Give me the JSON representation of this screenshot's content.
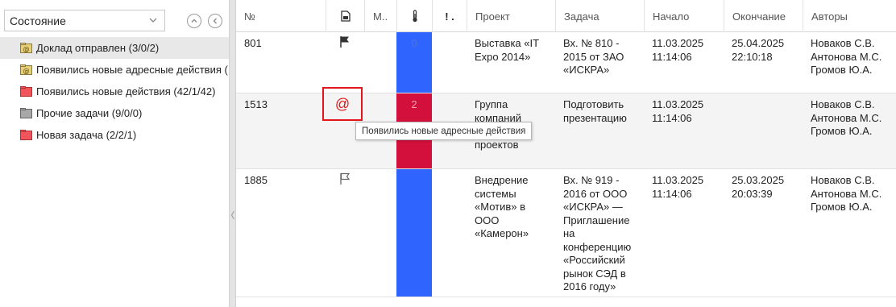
{
  "filter": {
    "selected": "Состояние"
  },
  "folders": [
    {
      "label": "Доклад отправлен (3/0/2)",
      "icon": "at-folder-icon",
      "color": "#c9a94a"
    },
    {
      "label": "Появились новые адресные действия (",
      "icon": "at-folder-icon",
      "color": "#c9a94a"
    },
    {
      "label": "Появились новые действия (42/1/42)",
      "icon": "folder-icon",
      "color": "#f2545b"
    },
    {
      "label": "Прочие задачи (9/0/0)",
      "icon": "folder-icon",
      "color": "#9e9e9e"
    },
    {
      "label": "Новая задача (2/2/1)",
      "icon": "folder-icon",
      "color": "#f2545b"
    }
  ],
  "columns": {
    "num": "№",
    "flag_icon": "document-icon",
    "m": "М..",
    "temp_icon": "thermometer-icon",
    "priority": "! .",
    "project": "Проект",
    "task": "Задача",
    "start": "Начало",
    "end": "Окончание",
    "authors": "Авторы"
  },
  "rows": [
    {
      "num": "801",
      "marker": "flag-filled-icon",
      "temp": "0",
      "temp_color": "#2f64ff",
      "project": "Выставка «IT Expo 2014»",
      "task": "Вх. № 810 - 2015 от ЗАО «ИСКРА»",
      "start": "11.03.2025 11:14:06",
      "end": "25.04.2025 22:10:18",
      "authors": "Новаков С.В. Антонова М.С. Громов Ю.А."
    },
    {
      "num": "1513",
      "marker": "@",
      "temp": "2",
      "temp_color": "#d3103b",
      "project": "Группа компаний Задачи вне проектов",
      "task": "Подготовить презентацию",
      "start": "11.03.2025 11:14:06",
      "end": "",
      "authors": "Новаков С.В. Антонова М.С. Громов Ю.А."
    },
    {
      "num": "1885",
      "marker": "flag-outline-icon",
      "temp": "",
      "temp_color": "#2f64ff",
      "project": "Внедрение системы «Мотив» в ООО «Камерон»",
      "task": "Вх. № 919 - 2016 от ООО «ИСКРА» — Приглашение на конференцию «Российский рынок СЭД в 2016 году»",
      "start": "11.03.2025 11:14:06",
      "end": "25.03.2025 20:03:39",
      "authors": "Новаков С.В. Антонова М.С. Громов Ю.А."
    }
  ],
  "tooltip": "Появились новые адресные действия"
}
